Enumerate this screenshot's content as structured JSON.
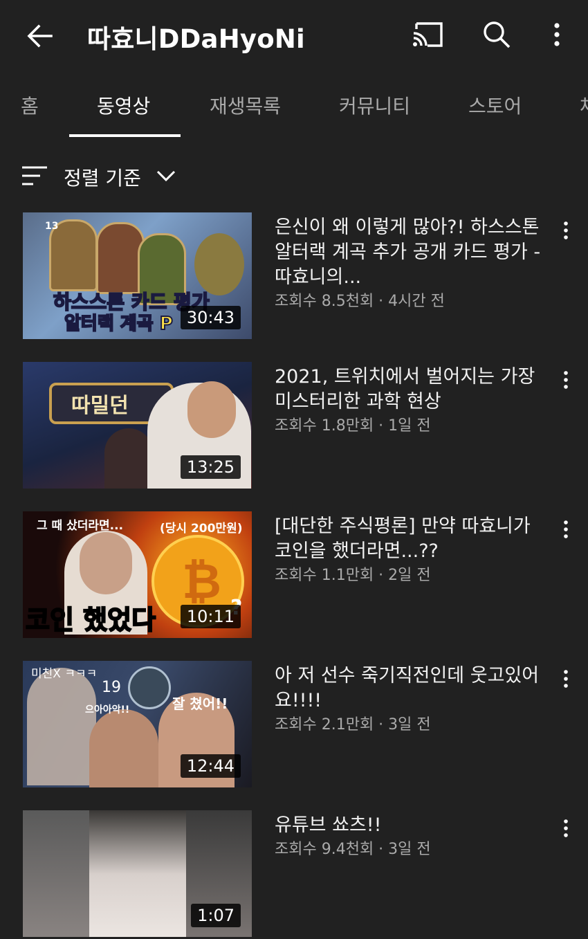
{
  "header": {
    "title": "따효니DDaHyoNi",
    "back_icon": "arrow-back-icon",
    "cast_icon": "cast-icon",
    "search_icon": "search-icon",
    "more_icon": "more-vert-icon"
  },
  "tabs": [
    {
      "label": "홈"
    },
    {
      "label": "동영상",
      "active": true
    },
    {
      "label": "재생목록"
    },
    {
      "label": "커뮤니티"
    },
    {
      "label": "스토어"
    },
    {
      "label": "채"
    }
  ],
  "sort": {
    "label": "정렬 기준"
  },
  "videos": [
    {
      "title": "은신이 왜 이렇게 많아?! 하스스톤 알터랙 계곡 추가 공개 카드 평가 - 따효니의...",
      "meta": "조회수 8.5천회 · 4시간 전",
      "duration": "30:43",
      "thumb_text": [
        "하스스톤 카드 평가",
        "알터랙 계곡 P",
        "13"
      ]
    },
    {
      "title": "2021, 트위치에서 벌어지는 가장 미스터리한 과학 현상",
      "meta": "조회수 1.8만회 · 1일 전",
      "duration": "13:25",
      "thumb_text": [
        "따밀던"
      ]
    },
    {
      "title": "[대단한 주식평론] 만약 따효니가 코인을 했더라면...??",
      "meta": "조회수 1.1만회 · 2일 전",
      "duration": "10:11",
      "thumb_text": [
        "그 때 샀더라면...",
        "(당시 200만원)",
        "코인 했었다",
        "?"
      ]
    },
    {
      "title": "아 저 선수 죽기직전인데 웃고있어요!!!!",
      "meta": "조회수 2.1만회 · 3일 전",
      "duration": "12:44",
      "thumb_text": [
        "미친X ㅋㅋㅋ",
        "19",
        "으아아악!!",
        "잘 쳤어!!"
      ]
    },
    {
      "title": "유튜브 쑈츠!!",
      "meta": "조회수 9.4천회 · 3일 전",
      "duration": "1:07",
      "thumb_text": []
    }
  ],
  "colors": {
    "background": "#212121",
    "text": "#ffffff",
    "secondary_text": "#aaaaaa"
  }
}
